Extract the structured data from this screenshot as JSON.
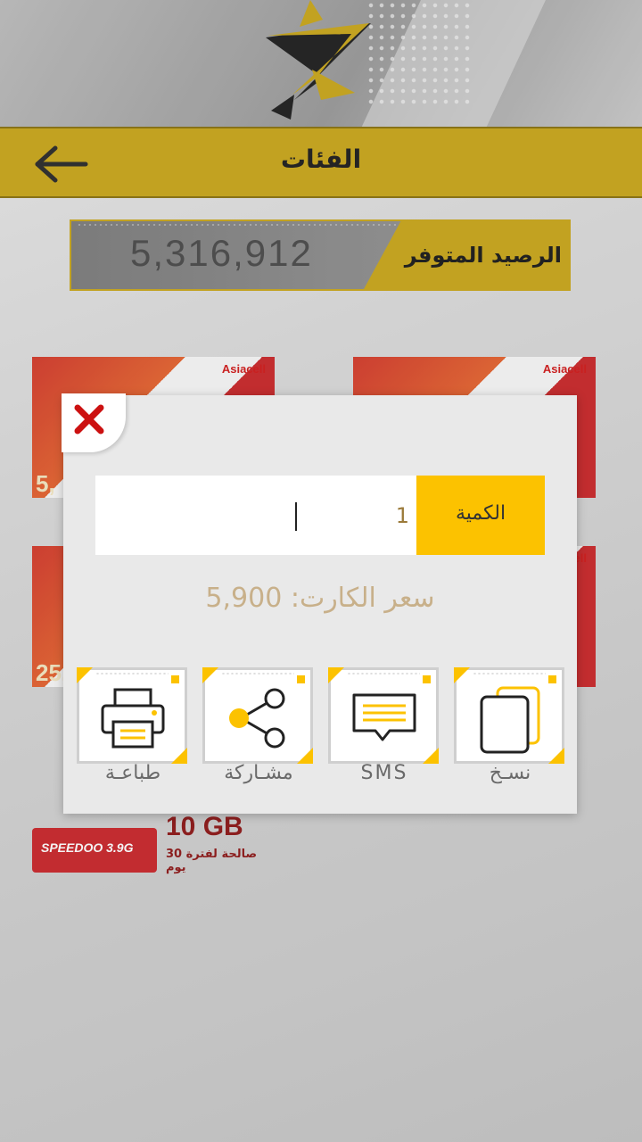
{
  "header": {
    "title": "الفئات"
  },
  "balance": {
    "label": "الرصيد المتوفر",
    "amount": "5,316,912"
  },
  "cards": [
    {
      "brand": "Asiacell",
      "price": "5,"
    },
    {
      "brand": "Asiacell",
      "price": ""
    },
    {
      "brand": "",
      "price": "25,"
    },
    {
      "brand": "Asiacell",
      "price": ""
    }
  ],
  "speed_card": {
    "brand": "SPEEDOO 3.9G",
    "size": "10 GB",
    "validity": "صالحة لفترة 30 يوم"
  },
  "modal": {
    "quantity_label": "الكمية",
    "quantity_value": "1",
    "price_text": "سعر الكارت: 5,900",
    "actions": [
      {
        "label": "طباعـة",
        "icon": "printer-icon"
      },
      {
        "label": "مشـاركة",
        "icon": "share-icon"
      },
      {
        "label": "SMS",
        "icon": "message-icon"
      },
      {
        "label": "نسـخ",
        "icon": "copy-icon"
      }
    ]
  },
  "colors": {
    "accent": "#c9a71b",
    "yellow": "#fcc200",
    "close_red": "#cc1111"
  }
}
